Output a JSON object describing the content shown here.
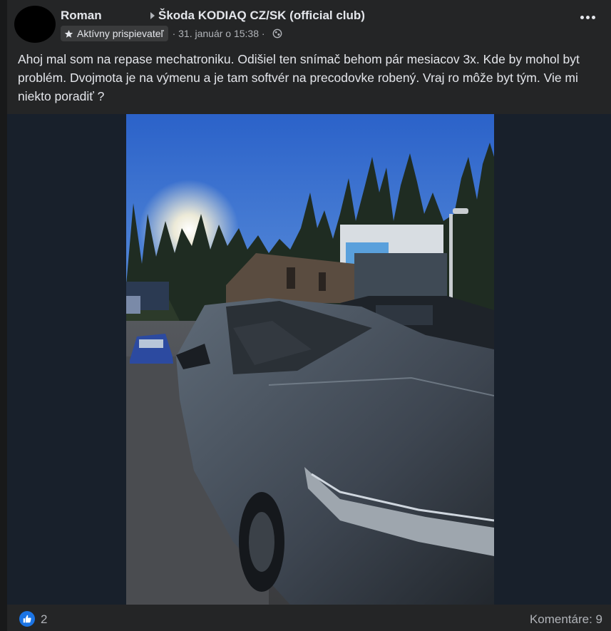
{
  "post": {
    "author": "Roman",
    "group": "Škoda KODIAQ CZ/SK (official club)",
    "badge": "Aktívny prispievateľ",
    "timestamp": "· 31. január o 15:38 ·",
    "text": "Ahoj mal som na repase mechatroniku. Odišiel ten snímač behom pár mesiacov 3x. Kde by mohol byt problém. Dvojmota je na výmenu a je tam softvér na precodovke robený. Vraj ro môže byt tým. Vie mi niekto poradiť ?",
    "icons": {
      "more": "more-options-icon",
      "badge": "star-icon",
      "audience": "globe-icon",
      "like": "thumbs-up-icon"
    }
  },
  "reactions": {
    "like_count": "2",
    "comments_label": "Komentáre: 9"
  },
  "colors": {
    "background": "#18191a",
    "card": "#242526",
    "text_primary": "#e4e6eb",
    "text_secondary": "#b0b3b8",
    "like_blue": "#1b74e4"
  }
}
